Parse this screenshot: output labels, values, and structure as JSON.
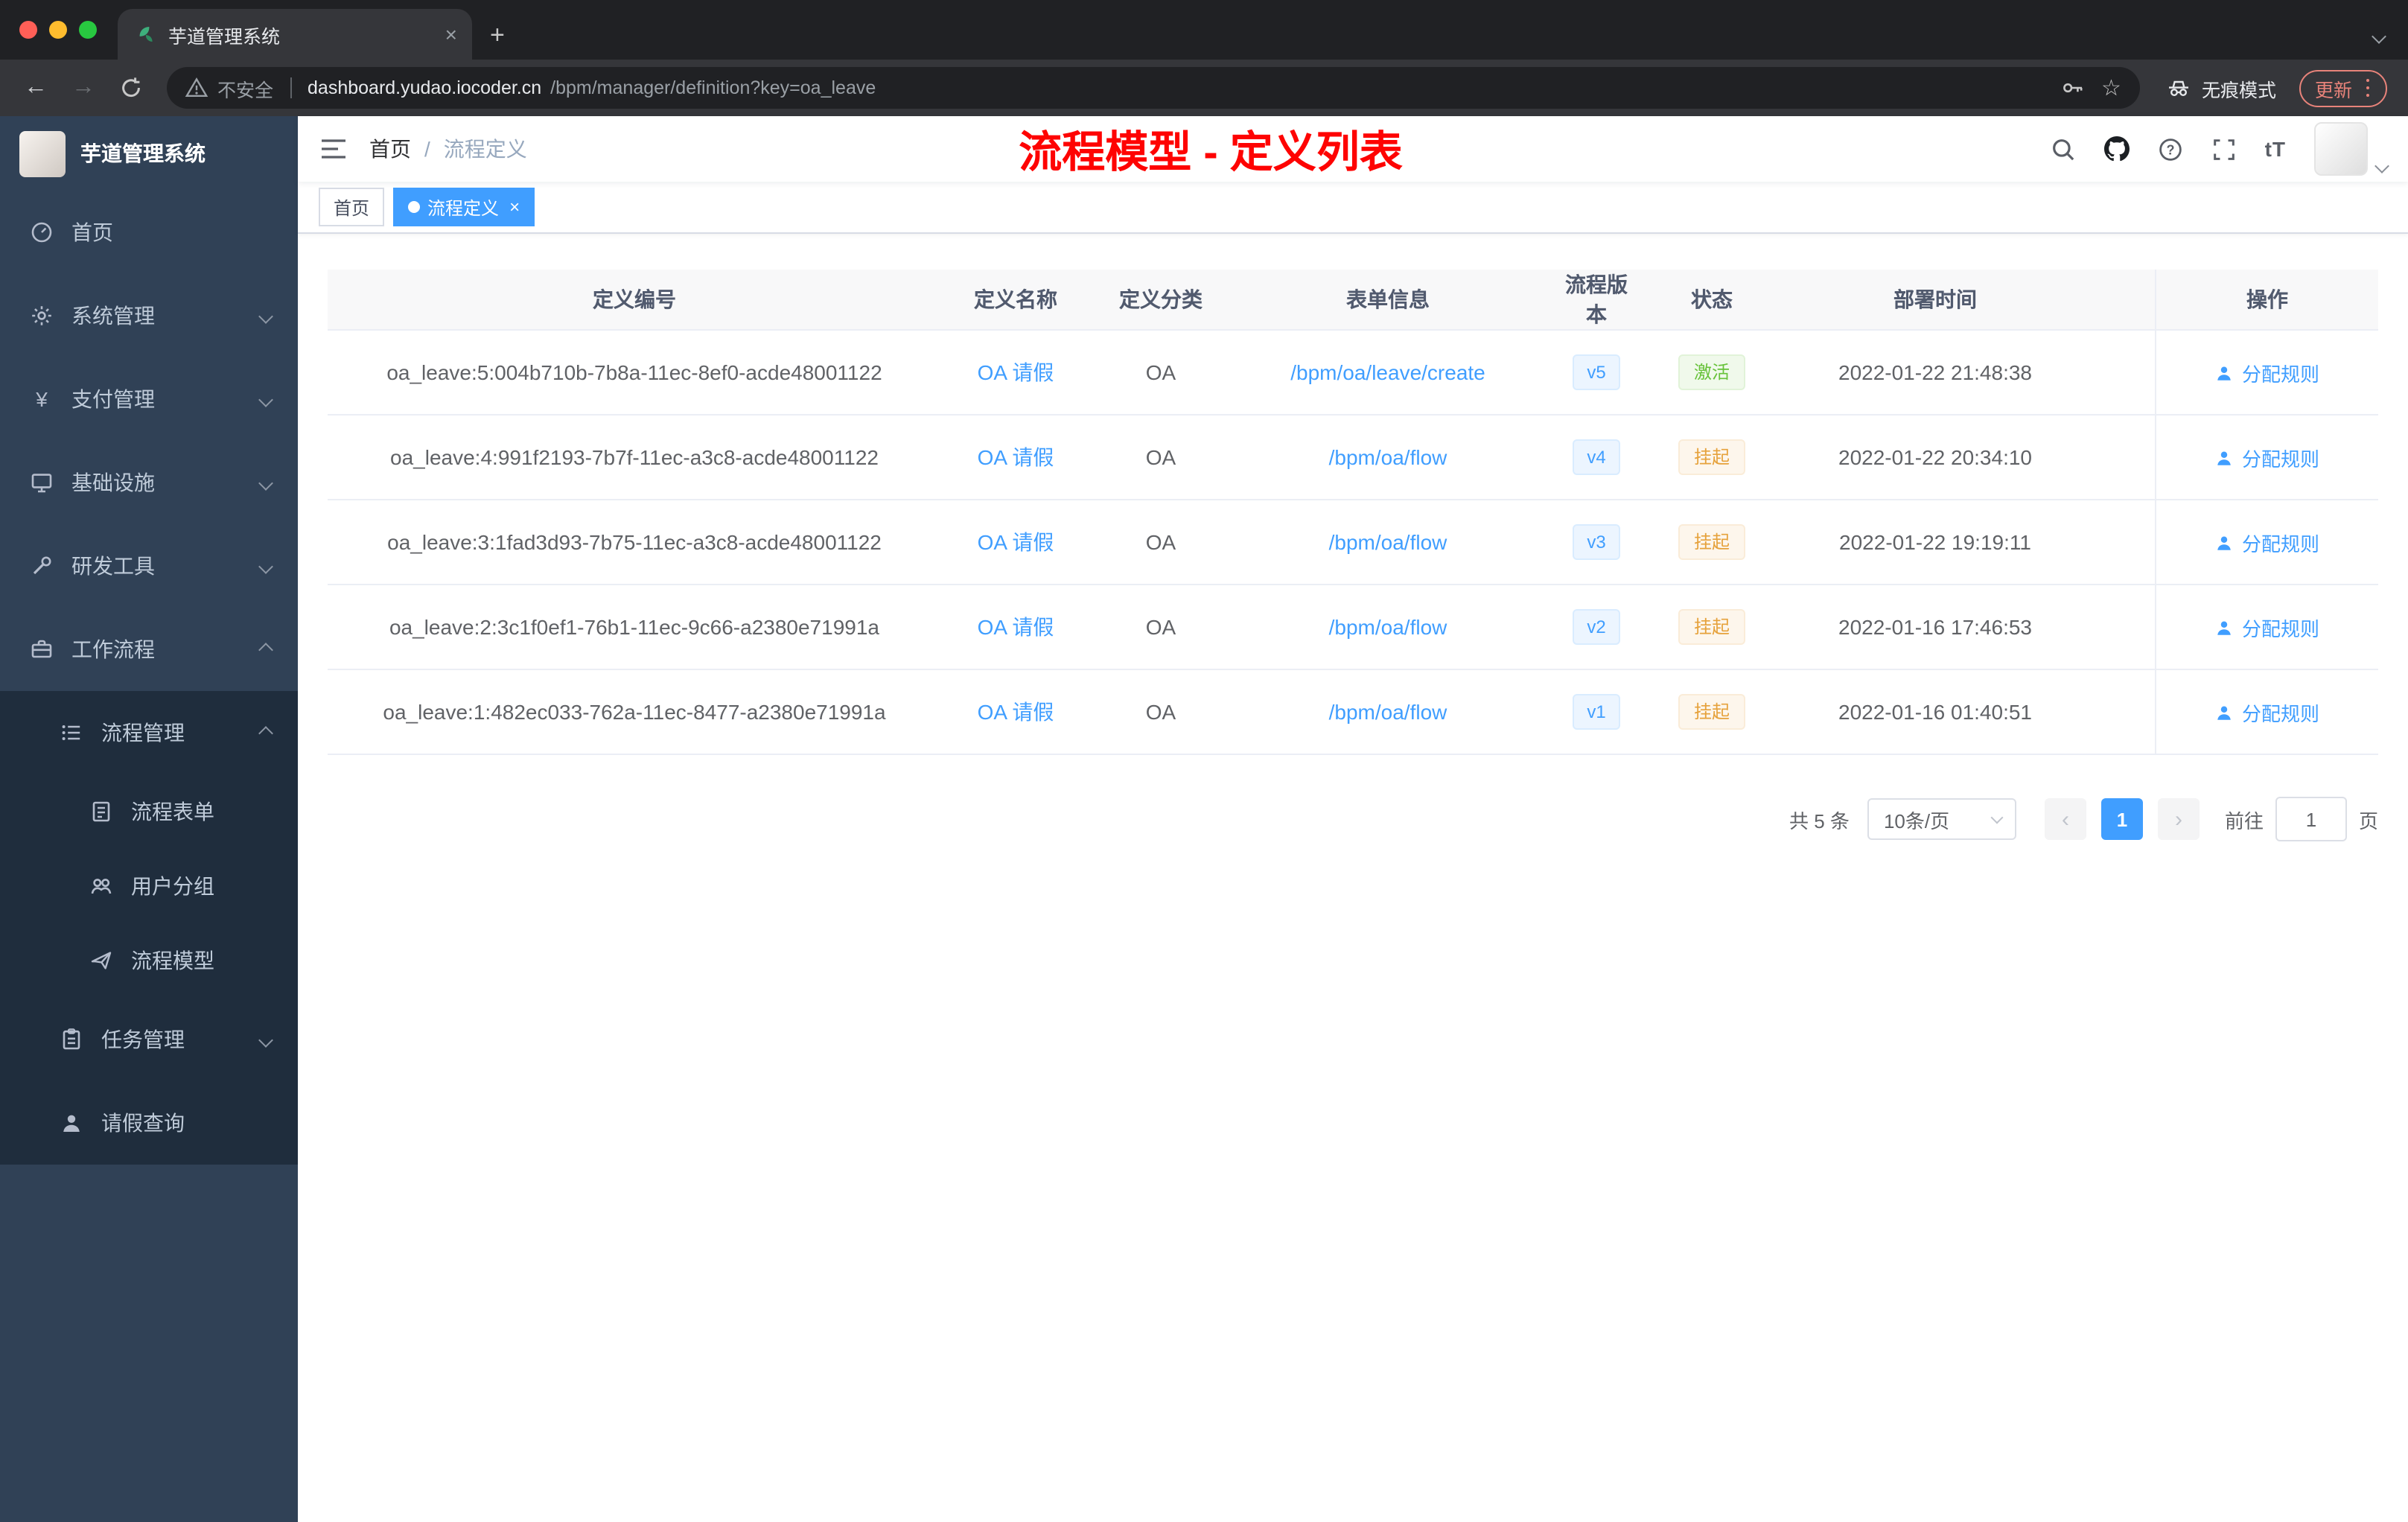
{
  "colors": {
    "accent": "#409eff",
    "success": "#67c23a",
    "warning": "#e6a23c",
    "title_red": "#fe0302",
    "sidebar_bg": "#304156",
    "submenu_bg": "#1f2d3d"
  },
  "browser": {
    "tab_title": "芋道管理系统",
    "security_label": "不安全",
    "url_domain": "dashboard.yudao.iocoder.cn",
    "url_path": "/bpm/manager/definition?key=oa_leave",
    "incognito_label": "无痕模式",
    "update_label": "更新"
  },
  "sidebar": {
    "logo_title": "芋道管理系统",
    "items": [
      {
        "label": "首页",
        "icon": "dashboard-icon"
      },
      {
        "label": "系统管理",
        "icon": "gear-icon"
      },
      {
        "label": "支付管理",
        "icon": "yen-icon"
      },
      {
        "label": "基础设施",
        "icon": "monitor-icon"
      },
      {
        "label": "研发工具",
        "icon": "tools-icon"
      },
      {
        "label": "工作流程",
        "icon": "briefcase-icon",
        "expanded": true,
        "children": [
          {
            "label": "流程管理",
            "icon": "list-icon",
            "expanded": true,
            "children": [
              {
                "label": "流程表单",
                "icon": "form-icon"
              },
              {
                "label": "用户分组",
                "icon": "users-icon"
              },
              {
                "label": "流程模型",
                "icon": "paper-plane-icon"
              }
            ]
          },
          {
            "label": "任务管理",
            "icon": "clipboard-icon"
          },
          {
            "label": "请假查询",
            "icon": "user-icon"
          }
        ]
      }
    ]
  },
  "header": {
    "breadcrumb_home": "首页",
    "breadcrumb_separator": "/",
    "breadcrumb_current": "流程定义",
    "page_title": "流程模型 - 定义列表"
  },
  "tags": [
    {
      "label": "首页",
      "active": false
    },
    {
      "label": "流程定义",
      "active": true
    }
  ],
  "table": {
    "columns": [
      "定义编号",
      "定义名称",
      "定义分类",
      "表单信息",
      "流程版本",
      "状态",
      "部署时间",
      "操作"
    ],
    "action_label": "分配规则",
    "rows": [
      {
        "id": "oa_leave:5:004b710b-7b8a-11ec-8ef0-acde48001122",
        "name": "OA 请假",
        "category": "OA",
        "form": "/bpm/oa/leave/create",
        "version": "v5",
        "status": "激活",
        "status_type": "success",
        "time": "2022-01-22 21:48:38"
      },
      {
        "id": "oa_leave:4:991f2193-7b7f-11ec-a3c8-acde48001122",
        "name": "OA 请假",
        "category": "OA",
        "form": "/bpm/oa/flow",
        "version": "v4",
        "status": "挂起",
        "status_type": "warning",
        "time": "2022-01-22 20:34:10"
      },
      {
        "id": "oa_leave:3:1fad3d93-7b75-11ec-a3c8-acde48001122",
        "name": "OA 请假",
        "category": "OA",
        "form": "/bpm/oa/flow",
        "version": "v3",
        "status": "挂起",
        "status_type": "warning",
        "time": "2022-01-22 19:19:11"
      },
      {
        "id": "oa_leave:2:3c1f0ef1-76b1-11ec-9c66-a2380e71991a",
        "name": "OA 请假",
        "category": "OA",
        "form": "/bpm/oa/flow",
        "version": "v2",
        "status": "挂起",
        "status_type": "warning",
        "time": "2022-01-16 17:46:53"
      },
      {
        "id": "oa_leave:1:482ec033-762a-11ec-8477-a2380e71991a",
        "name": "OA 请假",
        "category": "OA",
        "form": "/bpm/oa/flow",
        "version": "v1",
        "status": "挂起",
        "status_type": "warning",
        "time": "2022-01-16 01:40:51"
      }
    ]
  },
  "pagination": {
    "total": "共 5 条",
    "page_size": "10条/页",
    "current_page": "1",
    "goto_label": "前往",
    "goto_value": "1",
    "page_unit": "页"
  }
}
